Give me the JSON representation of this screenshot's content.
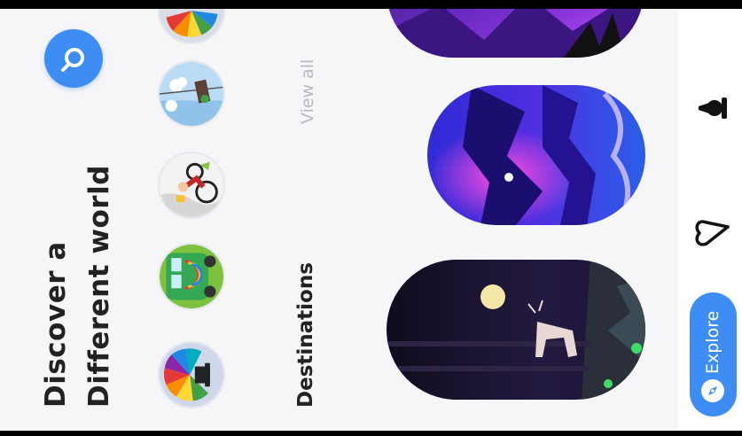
{
  "header": {
    "title_line1": "Discover a",
    "title_line2": "Different world"
  },
  "search": {
    "icon": "search-icon"
  },
  "categories": [
    {
      "name": "hot-air-balloon"
    },
    {
      "name": "camper-van"
    },
    {
      "name": "cycling"
    },
    {
      "name": "gondola"
    },
    {
      "name": "balloon-partial"
    }
  ],
  "section": {
    "title": "Destinations",
    "view_all": "View all"
  },
  "destinations": [
    {
      "name": "deer-moon-night"
    },
    {
      "name": "purple-canyon"
    },
    {
      "name": "violet-mountains"
    }
  ],
  "nav": {
    "explore_label": "Explore",
    "items": [
      {
        "icon": "compass-icon",
        "active": true
      },
      {
        "icon": "heart-icon",
        "active": false
      },
      {
        "icon": "profile-icon",
        "active": false
      }
    ]
  },
  "colors": {
    "accent": "#3d8df5",
    "background": "#f6f6f8",
    "text": "#222222"
  }
}
